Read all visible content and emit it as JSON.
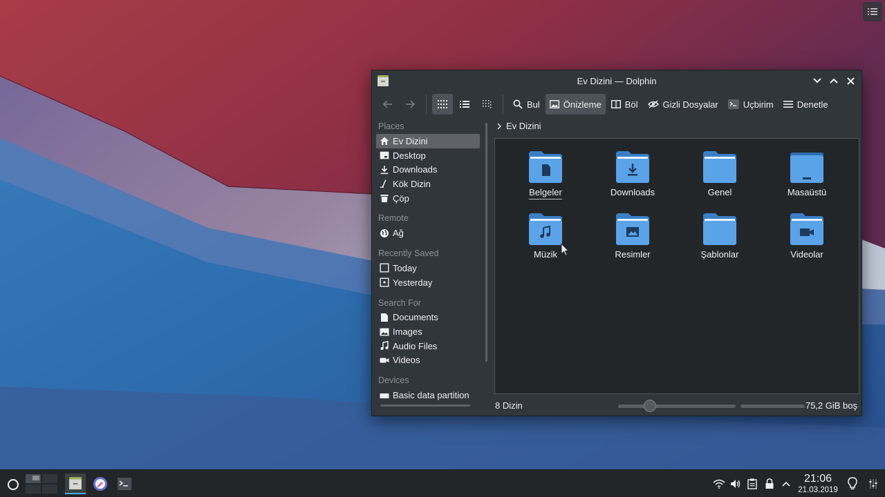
{
  "window": {
    "title": "Ev Dizini — Dolphin"
  },
  "toolbar": {
    "back": "back",
    "forward": "forward",
    "find": "Bul",
    "preview": "Önizleme",
    "split": "Böl",
    "hidden_files": "Gizli Dosyalar",
    "terminal": "Uçbirim",
    "control": "Denetle"
  },
  "sidebar": {
    "places_header": "Places",
    "places": [
      "Ev Dizini",
      "Desktop",
      "Downloads",
      "Kök Dizin",
      "Çöp"
    ],
    "remote_header": "Remote",
    "remote": [
      "Ağ"
    ],
    "recent_header": "Recently Saved",
    "recent": [
      "Today",
      "Yesterday"
    ],
    "search_header": "Search For",
    "search": [
      "Documents",
      "Images",
      "Audio Files",
      "Videos"
    ],
    "devices_header": "Devices",
    "devices_partial": "Basic data partition"
  },
  "breadcrumb": {
    "current": "Ev Dizini"
  },
  "folders": [
    {
      "name": "Belgeler",
      "icon": "document"
    },
    {
      "name": "Downloads",
      "icon": "download"
    },
    {
      "name": "Genel",
      "icon": "none"
    },
    {
      "name": "Masaüstü",
      "icon": "desktop"
    },
    {
      "name": "Müzik",
      "icon": "music"
    },
    {
      "name": "Resimler",
      "icon": "image"
    },
    {
      "name": "Şablonlar",
      "icon": "none"
    },
    {
      "name": "Videolar",
      "icon": "video"
    }
  ],
  "status": {
    "count": "8 Dizin",
    "free_space": "75,2 GiB boş"
  },
  "taskbar": {
    "time": "21:06",
    "date": "21.03.2019"
  },
  "colors": {
    "accent": "#3daee9",
    "folder": "#5aa3e8",
    "folder_dark": "#3a80c8",
    "window_bg": "#31363b",
    "view_bg": "#232629"
  }
}
